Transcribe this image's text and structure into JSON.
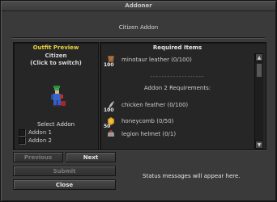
{
  "window": {
    "title": "Addoner"
  },
  "header": {
    "subtitle": "Citizen Addon"
  },
  "preview": {
    "title": "Outfit Preview",
    "outfit_name": "Citizen",
    "hint": "(Click to switch)",
    "select_label": "Select Addon",
    "addons": [
      "Addon 1",
      "Addon 2"
    ]
  },
  "requirements": {
    "title": "Required Items",
    "items": [
      {
        "qty": "100",
        "name": "minotaur leather (0/100)",
        "icon": "minotaur-leather-icon"
      }
    ],
    "separator": "-------------------",
    "section2_title": "Addon 2 Requirements:",
    "items2": [
      {
        "qty": "100",
        "name": "chicken feather (0/100)",
        "icon": "chicken-feather-icon"
      },
      {
        "qty": "50",
        "name": "honeycomb (0/50)",
        "icon": "honeycomb-icon"
      },
      {
        "qty": "",
        "name": "legion helmet (0/1)",
        "icon": "legion-helmet-icon"
      }
    ]
  },
  "buttons": {
    "previous": "Previous",
    "next": "Next",
    "submit": "Submit",
    "close": "Close"
  },
  "status": "Status messages will appear here.",
  "colors": {
    "accent_yellow": "#e8d23a",
    "window_bg": "#3a3a3a",
    "panel_bg": "#262626"
  }
}
